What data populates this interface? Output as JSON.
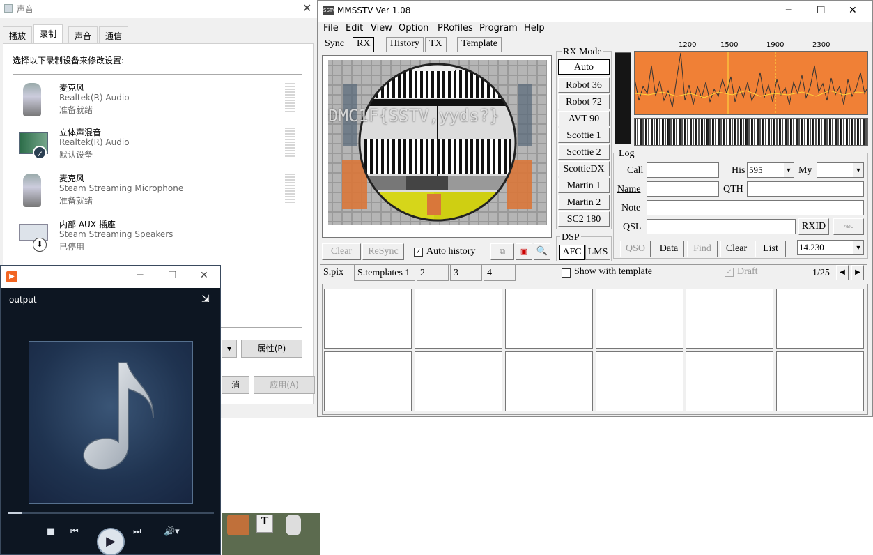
{
  "sound": {
    "title": "声音",
    "tabs": [
      "播放",
      "录制",
      "声音",
      "通信"
    ],
    "instruction": "选择以下录制设备来修改设置:",
    "devices": [
      {
        "name": "麦克风",
        "driver": "Realtek(R) Audio",
        "status": "准备就绪"
      },
      {
        "name": "立体声混音",
        "driver": "Realtek(R) Audio",
        "status": "默认设备"
      },
      {
        "name": "麦克风",
        "driver": "Steam Streaming Microphone",
        "status": "准备就绪"
      },
      {
        "name": "内部 AUX 插座",
        "driver": "Steam Streaming Speakers",
        "status": "已停用"
      }
    ],
    "properties_button": "属性(P)",
    "cancel_partial": "消",
    "apply_button": "应用(A)"
  },
  "player": {
    "output_label": "output"
  },
  "mmsstv": {
    "title": "MMSSTV Ver 1.08",
    "menu": [
      "File",
      "Edit",
      "View",
      "Option",
      "PRofiles",
      "Program",
      "Help"
    ],
    "tabs": [
      "Sync",
      "RX",
      "History",
      "TX",
      "Template"
    ],
    "rx_mode_title": "RX Mode",
    "modes": [
      "Auto",
      "Robot 36",
      "Robot 72",
      "AVT 90",
      "Scottie 1",
      "Scottie 2",
      "ScottieDX",
      "Martin 1",
      "Martin 2",
      "SC2 180"
    ],
    "freq_ticks": [
      "1200",
      "1500",
      "1900",
      "2300"
    ],
    "image_overlay_text": "DMC1F{SSTV,yyds?}",
    "buttons": {
      "clear": "Clear",
      "resync": "ReSync",
      "auto_history": "Auto history"
    },
    "dsp_title": "DSP",
    "afc": "AFC",
    "lms": "LMS",
    "log": {
      "title": "Log",
      "call": "Call",
      "his": "His",
      "his_value": "595",
      "my": "My",
      "name": "Name",
      "qth": "QTH",
      "note": "Note",
      "qsl": "QSL",
      "rxid": "RXID",
      "qso": "QSO",
      "data": "Data",
      "find": "Find",
      "clear": "Clear",
      "list": "List",
      "freq": "14.230"
    },
    "bottom_tabs": [
      "S.pix",
      "S.templates 1",
      "2",
      "3",
      "4"
    ],
    "show_with_template": "Show with template",
    "draft": "Draft",
    "page_count": "1/25"
  }
}
